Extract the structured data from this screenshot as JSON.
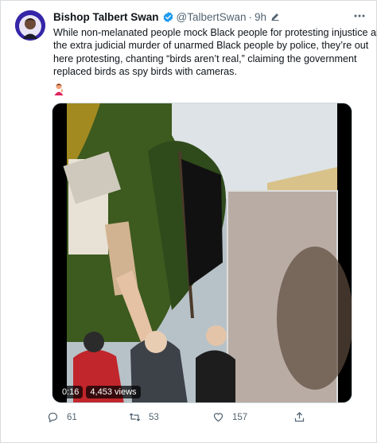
{
  "tweet": {
    "author_name": "Bishop Talbert Swan",
    "handle": "@TalbertSwan",
    "separator": "·",
    "time": "9h",
    "text_lines": [
      "While non-melanated people mock Black people for protesting injustice and",
      "the extra judicial murder of unarmed Black people by police, they’re out",
      "here protesting, chanting “birds aren’t real,” claiming the government",
      "replaced birds as spy birds with cameras."
    ]
  },
  "media": {
    "duration": "0:16",
    "views": "4,453 views"
  },
  "actions": {
    "replies": "61",
    "retweets": "53",
    "likes": "157"
  },
  "colors": {
    "text": "#0f1419",
    "secondary": "#536471",
    "verified": "#1d9bf0",
    "border": "#d7dce0"
  },
  "icons": [
    "verified-badge-icon",
    "edit-icon",
    "more-icon",
    "person-gesturing-emoji",
    "reply-icon",
    "retweet-icon",
    "like-icon",
    "share-icon"
  ]
}
